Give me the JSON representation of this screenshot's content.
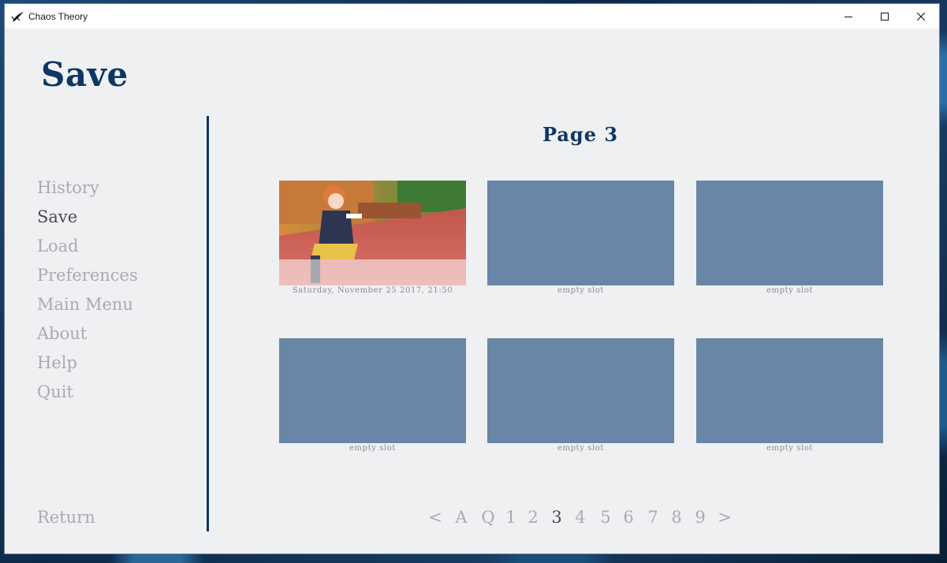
{
  "window": {
    "title": "Chaos Theory"
  },
  "screen": {
    "title": "Save",
    "page_title": "Page 3"
  },
  "nav": {
    "items": [
      {
        "label": "History",
        "active": false
      },
      {
        "label": "Save",
        "active": true
      },
      {
        "label": "Load",
        "active": false
      },
      {
        "label": "Preferences",
        "active": false
      },
      {
        "label": "Main Menu",
        "active": false
      },
      {
        "label": "About",
        "active": false
      },
      {
        "label": "Help",
        "active": false
      },
      {
        "label": "Quit",
        "active": false
      }
    ],
    "return_label": "Return"
  },
  "slots": [
    {
      "label": "Saturday, November 25 2017, 21:50",
      "filled": true
    },
    {
      "label": "empty slot",
      "filled": false
    },
    {
      "label": "empty slot",
      "filled": false
    },
    {
      "label": "empty slot",
      "filled": false
    },
    {
      "label": "empty slot",
      "filled": false
    },
    {
      "label": "empty slot",
      "filled": false
    }
  ],
  "pager": {
    "prev": "<",
    "auto": "A",
    "quick": "Q",
    "pages": [
      "1",
      "2",
      "3",
      "4",
      "5",
      "6",
      "7",
      "8",
      "9"
    ],
    "current": "3",
    "next": ">"
  },
  "colors": {
    "accent": "#0d3663",
    "idle_text": "#a9abaf",
    "selected_text": "#4a4c50",
    "empty_slot": "#6886a6",
    "background": "#eff0f2"
  }
}
